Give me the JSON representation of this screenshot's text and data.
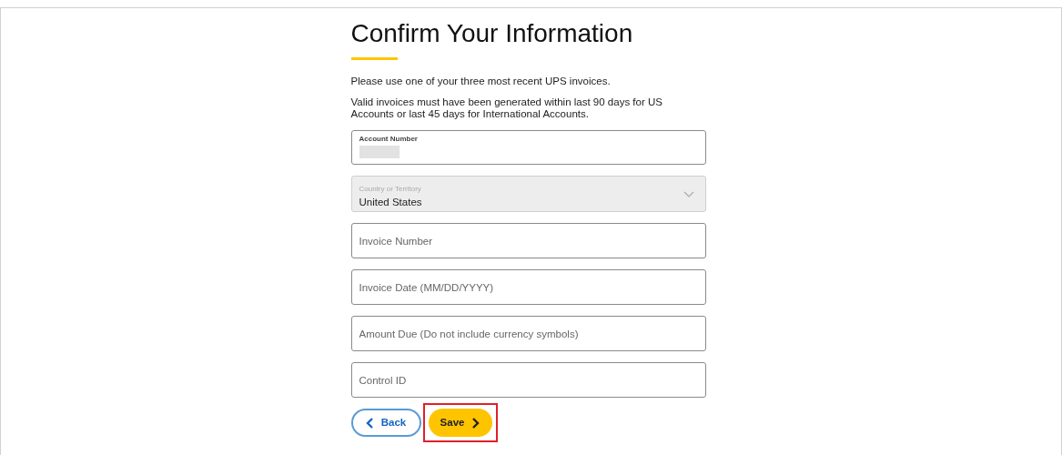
{
  "title": "Confirm Your Information",
  "paragraphs": [
    "Please use one of your three most recent UPS invoices.",
    "Valid invoices must have been generated within last 90 days for US Accounts or last 45 days for International Accounts."
  ],
  "fields": [
    {
      "kind": "redacted",
      "label": "Account Number",
      "disabled": false
    },
    {
      "kind": "select",
      "label": "Country or Territory",
      "value": "United States",
      "disabled": true
    },
    {
      "kind": "text",
      "placeholder": "Invoice Number",
      "disabled": false
    },
    {
      "kind": "text",
      "placeholder": "Invoice Date (MM/DD/YYYY)",
      "disabled": false
    },
    {
      "kind": "text",
      "placeholder": "Amount Due (Do not include currency symbols)",
      "disabled": false
    },
    {
      "kind": "text",
      "placeholder": "Control ID",
      "disabled": false
    }
  ],
  "buttons": [
    {
      "kind": "back",
      "label": "Back",
      "highlighted": false
    },
    {
      "kind": "save",
      "label": "Save",
      "highlighted": true
    }
  ]
}
